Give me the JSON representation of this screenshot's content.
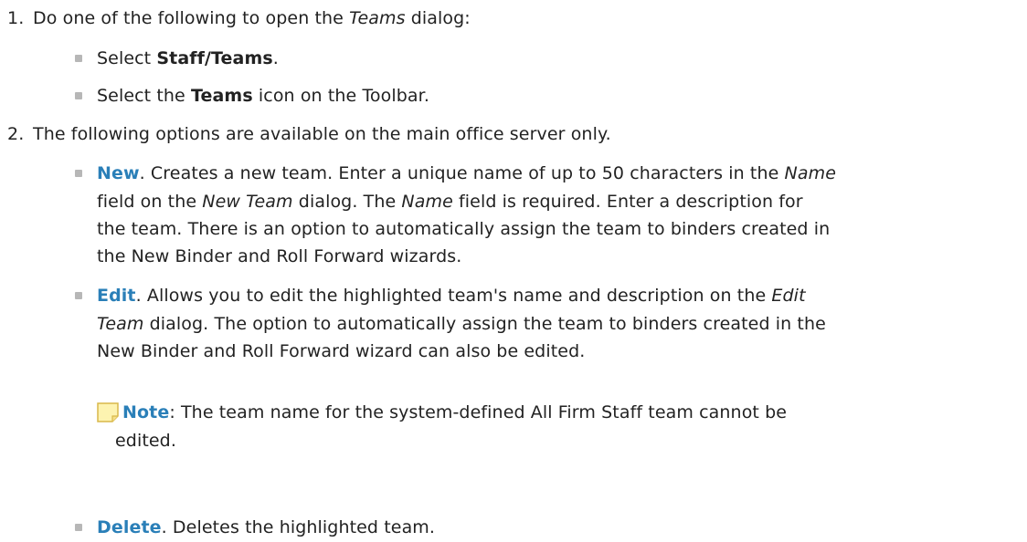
{
  "steps": [
    {
      "number": "1.",
      "intro": "Do one of the following to open the ",
      "intro_em": "Teams",
      "intro_end": " dialog:",
      "bullets": [
        {
          "pre": "Select ",
          "bold": "Staff/Teams",
          "post": "."
        },
        {
          "pre": "Select the ",
          "bold": "Teams",
          "post": " icon on the Toolbar."
        }
      ]
    },
    {
      "number": "2.",
      "intro": "The following options are available on the main office server only.",
      "options": [
        {
          "term": "New",
          "lines": [
            {
              "a": ". Creates a new team. Enter a unique name of up to 50 characters in the ",
              "em": "Name"
            },
            {
              "em1": "field on the ",
              "em1_text": "New Team",
              "b": " dialog. The ",
              "em2": "Name",
              "c": " field is required. Enter a description for"
            },
            {
              "text": "the team. There is an option to automatically assign the team to binders created in"
            },
            {
              "text": "the New Binder and Roll Forward wizards."
            }
          ]
        },
        {
          "term": "Edit",
          "lines": [
            {
              "a": ". Allows you to edit the highlighted team's name and description on the ",
              "em": "Edit"
            },
            {
              "em": "Team",
              "b": " dialog. The option to automatically assign the team to binders created in the"
            },
            {
              "text": "New Binder and Roll Forward wizard can also be edited."
            }
          ],
          "note": {
            "label": "Note",
            "line1": ": The team name for the system-defined All Firm Staff team cannot be",
            "line2": "edited."
          }
        },
        {
          "term": "Delete",
          "lines": [
            {
              "a": ". Deletes the highlighted team."
            }
          ]
        }
      ]
    }
  ],
  "colors": {
    "text": "#222222",
    "term": "#2a7fb8",
    "bullet": "#b7b7b7",
    "note_icon_fill": "#fdf3b0",
    "note_icon_border": "#d9b84a"
  },
  "icons": {
    "note": "note-icon"
  }
}
